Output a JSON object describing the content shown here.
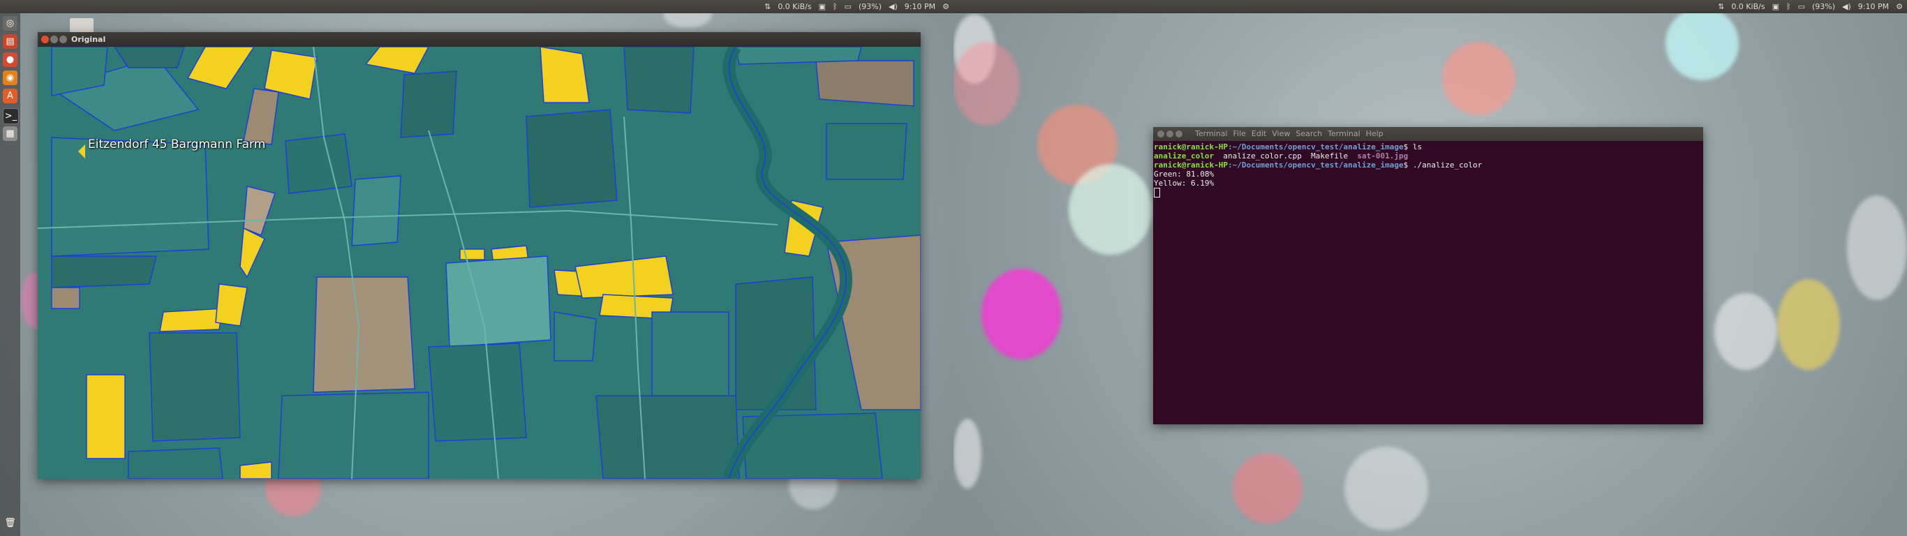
{
  "desktop_left": {
    "window": {
      "title": "Original",
      "map_label": "Eitzendorf 45 Bargmann Farm"
    }
  },
  "topbar": {
    "net_speed": "0.0 KiB/s",
    "battery": "(93%)",
    "clock": "9:10 PM"
  },
  "launcher": {
    "icons": [
      "dash-icon",
      "files-icon",
      "browser-icon",
      "firefox-icon",
      "software-center-icon",
      "terminal-icon",
      "workspace-icon",
      "trash-icon"
    ]
  },
  "terminal": {
    "menu": [
      "Terminal",
      "File",
      "Edit",
      "View",
      "Search",
      "Terminal",
      "Help"
    ],
    "line1_user": "ranick@ranick-HP",
    "line1_path": ":~/Documents/opencv_test/analize_image",
    "line1_cmd": "$ ls",
    "line2_exec": "analize_color",
    "line2_rest": "  analize_color.cpp  Makefile  ",
    "line2_img": "sat-001.jpg",
    "line3_user": "ranick@ranick-HP",
    "line3_path": ":~/Documents/opencv_test/analize_image",
    "line3_cmd": "$ ./analize_color",
    "line4": "Green: 81.08%",
    "line5": "Yellow: 6.19%"
  }
}
